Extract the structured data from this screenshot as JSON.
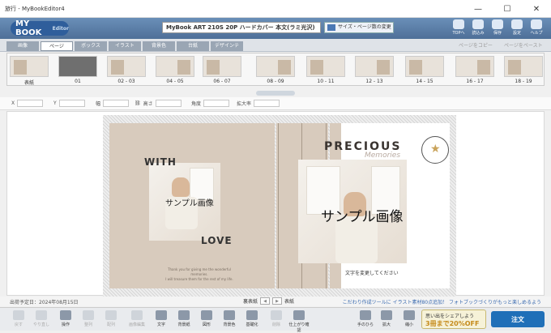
{
  "window": {
    "title": "旅行 - MyBookEditor4",
    "min": "—",
    "max": "☐",
    "close": "✕"
  },
  "app": {
    "logo": "MY BOOK",
    "logo_sub": "Editor",
    "product": "MyBook ART 210S 20P ハードカバー 本文(ラミ光沢)",
    "size_button": "サイズ・ページ数の変更"
  },
  "top_icons": [
    {
      "name": "top-icon-home",
      "label": "TOPへ"
    },
    {
      "name": "top-icon-open",
      "label": "読込み"
    },
    {
      "name": "top-icon-save",
      "label": "保存"
    },
    {
      "name": "top-icon-settings",
      "label": "設定"
    },
    {
      "name": "top-icon-help",
      "label": "ヘルプ"
    }
  ],
  "tabs": [
    "画像",
    "ページ",
    "ボックス",
    "イラスト",
    "背景色",
    "台紙",
    "デザインテ"
  ],
  "tabs_right": [
    "ページをコピー",
    "ページをペースト"
  ],
  "thumbnails": [
    {
      "label": "表紙"
    },
    {
      "label": "01"
    },
    {
      "label": "02 - 03"
    },
    {
      "label": "04 - 05"
    },
    {
      "label": "06 - 07"
    },
    {
      "label": "08 - 09"
    },
    {
      "label": "10 - 11"
    },
    {
      "label": "12 - 13"
    },
    {
      "label": "14 - 15"
    },
    {
      "label": "16 - 17"
    },
    {
      "label": "18 - 19"
    }
  ],
  "props": {
    "x": "X",
    "y": "Y",
    "width": "幅",
    "height": "高さ",
    "angle": "角度",
    "zoom": "拡大率"
  },
  "canvas": {
    "sample_left": "サンプル画像",
    "sample_right": "サンプル画像",
    "with": "WITH",
    "love": "LOVE",
    "back_text_1": "Thank you for giving me the wonderful memories.",
    "back_text_2": "I will treasure them for the rest of my life.",
    "precious": "PRECIOUS",
    "memories": "Memories",
    "caption": "文字を変更してください"
  },
  "status": {
    "left": "出荷予定日：2024年08月15日",
    "mid_left": "裏表紙",
    "mid_right": "表紙",
    "prev": "◀",
    "next": "▶",
    "right": "こだわり作成ツールに イラスト素材80点追加！ フォトブックづくりがもっと楽しめるよう"
  },
  "toolbar": [
    {
      "name": "undo-button",
      "label": "戻す",
      "disabled": true
    },
    {
      "name": "redo-button",
      "label": "やり直し",
      "disabled": true
    },
    {
      "name": "operate-button",
      "label": "操作",
      "disabled": false
    },
    {
      "name": "align-button",
      "label": "整列",
      "disabled": true
    },
    {
      "name": "layer-button",
      "label": "配列",
      "disabled": true
    },
    {
      "name": "image-edit-button",
      "label": "画像編集",
      "disabled": true
    },
    {
      "name": "text-button",
      "label": "文字",
      "disabled": false
    },
    {
      "name": "background-button",
      "label": "背景紙",
      "disabled": false
    },
    {
      "name": "shape-button",
      "label": "図形",
      "disabled": false
    },
    {
      "name": "bgcolor-button",
      "label": "背景色",
      "disabled": false
    },
    {
      "name": "layout-button",
      "label": "基礎化",
      "disabled": false
    },
    {
      "name": "delete-button",
      "label": "削除",
      "disabled": true
    },
    {
      "name": "finish-button",
      "label": "仕上がり確認",
      "disabled": false
    },
    {
      "name": "hand-button",
      "label": "手のひら",
      "disabled": false
    },
    {
      "name": "zoom-in-button",
      "label": "拡大",
      "disabled": false
    },
    {
      "name": "zoom-out-button",
      "label": "縮小",
      "disabled": false
    }
  ],
  "promo": {
    "line1": "思い出をシェアしよう",
    "line2": "3冊まで20%OFF"
  },
  "order": "注文"
}
